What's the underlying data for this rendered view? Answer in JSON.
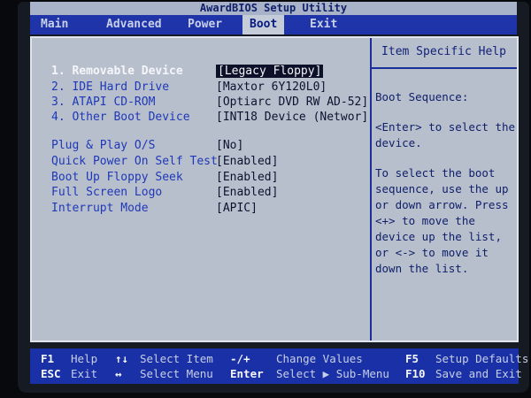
{
  "title": "AwardBIOS Setup Utility",
  "menu": [
    {
      "label": "Main",
      "active": false
    },
    {
      "label": "Advanced",
      "active": false
    },
    {
      "label": "Power",
      "active": false
    },
    {
      "label": "Boot",
      "active": true
    },
    {
      "label": "Exit",
      "active": false
    }
  ],
  "settings": [
    {
      "label": "1. Removable Device",
      "value": "[Legacy Floppy]",
      "selected": true
    },
    {
      "label": "2. IDE Hard Drive",
      "value": "[Maxtor 6Y120L0]",
      "selected": false
    },
    {
      "label": "3. ATAPI CD-ROM",
      "value": "[Optiarc DVD RW AD-52]",
      "selected": false
    },
    {
      "label": "4. Other Boot Device",
      "value": "[INT18 Device (Networ]",
      "selected": false
    },
    {
      "label": "Plug & Play O/S",
      "value": "[No]",
      "selected": false
    },
    {
      "label": "Quick Power On Self Test",
      "value": "[Enabled]",
      "selected": false
    },
    {
      "label": "Boot Up Floppy Seek",
      "value": "[Enabled]",
      "selected": false
    },
    {
      "label": "Full Screen Logo",
      "value": "[Enabled]",
      "selected": false
    },
    {
      "label": "Interrupt Mode",
      "value": "[APIC]",
      "selected": false
    }
  ],
  "help": {
    "title": "Item Specific Help",
    "para1": "Boot Sequence:",
    "para2": "<Enter> to select the device.",
    "para3": "To select the boot sequence, use the up or down arrow. Press <+> to move the device up the list, or <-> to move it down the list."
  },
  "footer": {
    "f1_key": "F1",
    "f1_desc": "Help",
    "arrows_key": "↑↓",
    "arrows_desc": "Select Item",
    "pm_key": "-/+",
    "pm_desc": "Change Values",
    "f5_key": "F5",
    "f5_desc": "Setup Defaults",
    "esc_key": "ESC",
    "esc_desc": "Exit",
    "lr_key": "↔",
    "lr_desc": "Select Menu",
    "enter_key": "Enter",
    "enter_desc": "Select ▶ Sub-Menu",
    "f10_key": "F10",
    "f10_desc": "Save and Exit"
  }
}
